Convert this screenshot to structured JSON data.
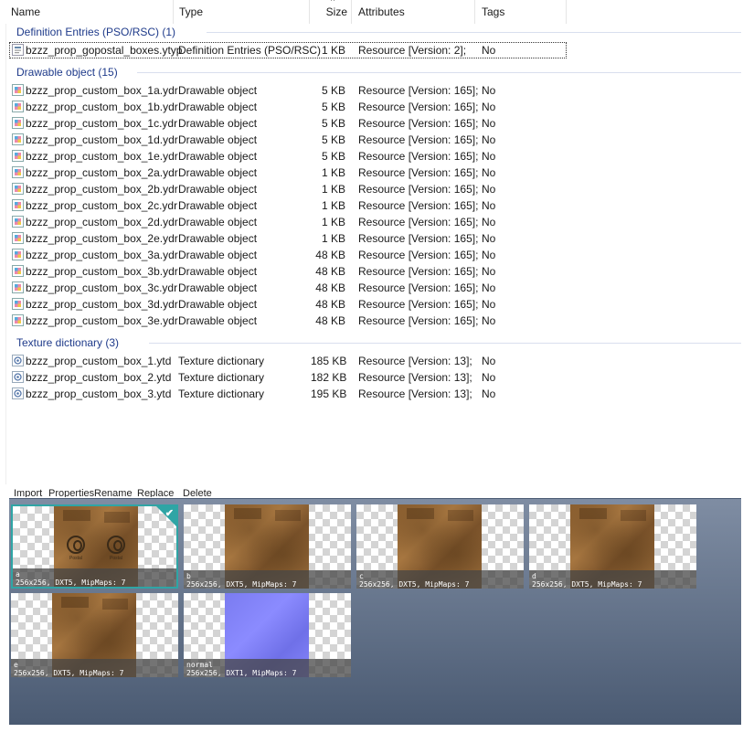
{
  "columns": {
    "name": "Name",
    "type": "Type",
    "size": "Size",
    "attributes": "Attributes",
    "tags": "Tags"
  },
  "groups": [
    {
      "title": "Definition Entries (PSO/RSC) (1)",
      "icon": "ytyp-file-icon",
      "rows": [
        {
          "name": "bzzz_prop_gopostal_boxes.ytyp",
          "type": "Definition Entries (PSO/RSC)",
          "size": "1 KB",
          "attr": "Resource [Version: 2];",
          "tags": "No",
          "selected": true
        }
      ]
    },
    {
      "title": "Drawable object (15)",
      "icon": "ydr-file-icon",
      "rows": [
        {
          "name": "bzzz_prop_custom_box_1a.ydr",
          "type": "Drawable object",
          "size": "5 KB",
          "attr": "Resource [Version: 165];",
          "tags": "No"
        },
        {
          "name": "bzzz_prop_custom_box_1b.ydr",
          "type": "Drawable object",
          "size": "5 KB",
          "attr": "Resource [Version: 165];",
          "tags": "No"
        },
        {
          "name": "bzzz_prop_custom_box_1c.ydr",
          "type": "Drawable object",
          "size": "5 KB",
          "attr": "Resource [Version: 165];",
          "tags": "No"
        },
        {
          "name": "bzzz_prop_custom_box_1d.ydr",
          "type": "Drawable object",
          "size": "5 KB",
          "attr": "Resource [Version: 165];",
          "tags": "No"
        },
        {
          "name": "bzzz_prop_custom_box_1e.ydr",
          "type": "Drawable object",
          "size": "5 KB",
          "attr": "Resource [Version: 165];",
          "tags": "No"
        },
        {
          "name": "bzzz_prop_custom_box_2a.ydr",
          "type": "Drawable object",
          "size": "1 KB",
          "attr": "Resource [Version: 165];",
          "tags": "No"
        },
        {
          "name": "bzzz_prop_custom_box_2b.ydr",
          "type": "Drawable object",
          "size": "1 KB",
          "attr": "Resource [Version: 165];",
          "tags": "No"
        },
        {
          "name": "bzzz_prop_custom_box_2c.ydr",
          "type": "Drawable object",
          "size": "1 KB",
          "attr": "Resource [Version: 165];",
          "tags": "No"
        },
        {
          "name": "bzzz_prop_custom_box_2d.ydr",
          "type": "Drawable object",
          "size": "1 KB",
          "attr": "Resource [Version: 165];",
          "tags": "No"
        },
        {
          "name": "bzzz_prop_custom_box_2e.ydr",
          "type": "Drawable object",
          "size": "1 KB",
          "attr": "Resource [Version: 165];",
          "tags": "No"
        },
        {
          "name": "bzzz_prop_custom_box_3a.ydr",
          "type": "Drawable object",
          "size": "48 KB",
          "attr": "Resource [Version: 165];",
          "tags": "No"
        },
        {
          "name": "bzzz_prop_custom_box_3b.ydr",
          "type": "Drawable object",
          "size": "48 KB",
          "attr": "Resource [Version: 165];",
          "tags": "No"
        },
        {
          "name": "bzzz_prop_custom_box_3c.ydr",
          "type": "Drawable object",
          "size": "48 KB",
          "attr": "Resource [Version: 165];",
          "tags": "No"
        },
        {
          "name": "bzzz_prop_custom_box_3d.ydr",
          "type": "Drawable object",
          "size": "48 KB",
          "attr": "Resource [Version: 165];",
          "tags": "No"
        },
        {
          "name": "bzzz_prop_custom_box_3e.ydr",
          "type": "Drawable object",
          "size": "48 KB",
          "attr": "Resource [Version: 165];",
          "tags": "No"
        }
      ]
    },
    {
      "title": "Texture dictionary (3)",
      "icon": "ytd-file-icon",
      "rows": [
        {
          "name": "bzzz_prop_custom_box_1.ytd",
          "type": "Texture dictionary",
          "size": "185 KB",
          "attr": "Resource [Version: 13];",
          "tags": "No"
        },
        {
          "name": "bzzz_prop_custom_box_2.ytd",
          "type": "Texture dictionary",
          "size": "182 KB",
          "attr": "Resource [Version: 13];",
          "tags": "No"
        },
        {
          "name": "bzzz_prop_custom_box_3.ytd",
          "type": "Texture dictionary",
          "size": "195 KB",
          "attr": "Resource [Version: 13];",
          "tags": "No"
        }
      ]
    }
  ],
  "toolbar": [
    "Import",
    "Properties",
    "Rename",
    "Replace",
    "Delete"
  ],
  "textures": [
    {
      "name": "a",
      "info": "256x256, DXT5, MipMaps: 7",
      "kind": "wood",
      "logos": true,
      "selected": true,
      "logo_text": "Postal"
    },
    {
      "name": "b",
      "info": "256x256, DXT5, MipMaps: 7",
      "kind": "wood"
    },
    {
      "name": "c",
      "info": "256x256, DXT5, MipMaps: 7",
      "kind": "wood"
    },
    {
      "name": "d",
      "info": "256x256, DXT5, MipMaps: 7",
      "kind": "wood"
    },
    {
      "name": "e",
      "info": "256x256, DXT5, MipMaps: 7",
      "kind": "wood"
    },
    {
      "name": "normal",
      "info": "256x256, DXT1, MipMaps: 7",
      "kind": "normal"
    }
  ]
}
